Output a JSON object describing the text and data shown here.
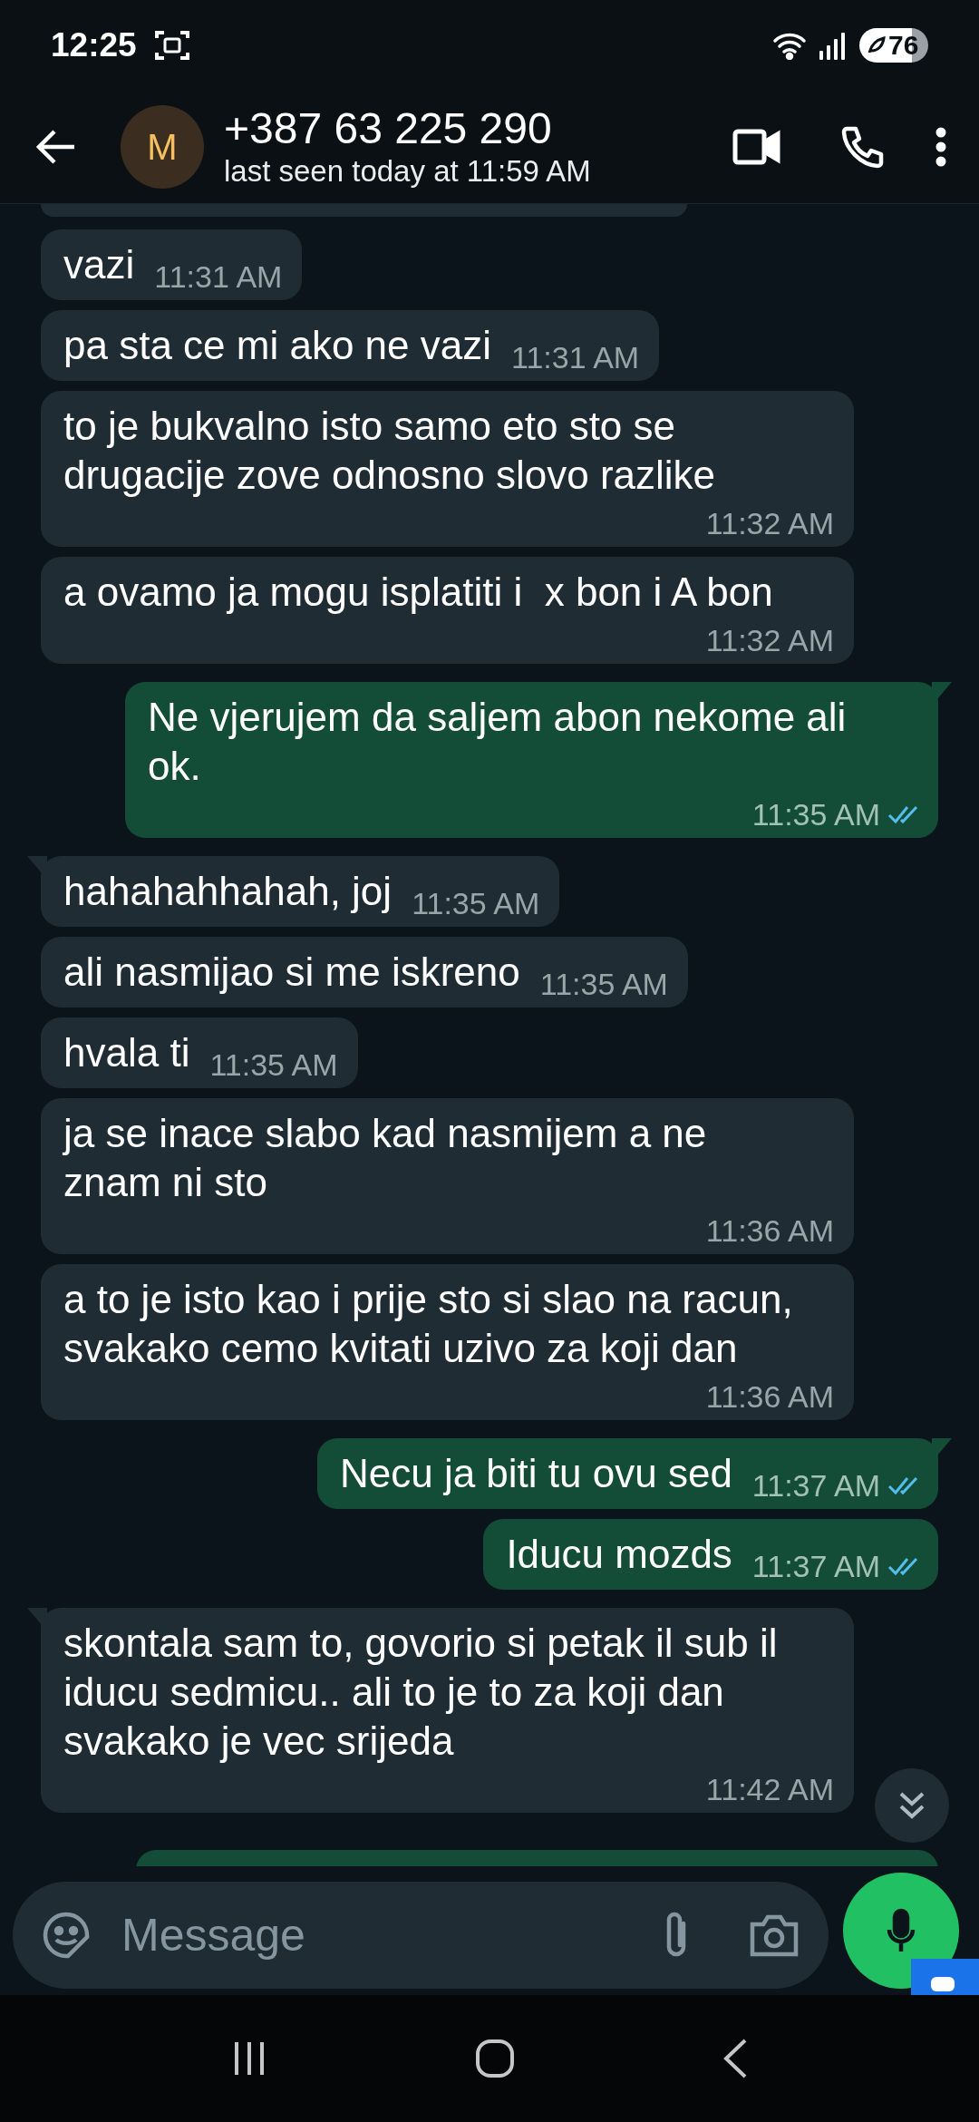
{
  "status_bar": {
    "time": "12:25",
    "battery": "76"
  },
  "header": {
    "avatar_letter": "M",
    "name": "+387 63 225 290",
    "last_seen": "last seen today at 11:59 AM"
  },
  "messages": [
    {
      "kind": "incoming",
      "tail": false,
      "text": "vazi",
      "time": "11:31 AM"
    },
    {
      "kind": "incoming",
      "tail": false,
      "text": "pa sta ce mi ako ne vazi",
      "time": "11:31 AM"
    },
    {
      "kind": "incoming",
      "tail": false,
      "text": "to je bukvalno isto samo eto sto se drugacije zove odnosno slovo razlike",
      "time": "11:32 AM"
    },
    {
      "kind": "incoming",
      "tail": false,
      "text": "a ovamo ja mogu isplatiti i  x bon i A bon",
      "time": "11:32 AM"
    },
    {
      "kind": "outgoing",
      "tail": true,
      "text": "Ne vjerujem da saljem abon nekome ali ok.",
      "time": "11:35 AM",
      "read": true
    },
    {
      "kind": "incoming",
      "tail": true,
      "text": "hahahahhahah, joj",
      "time": "11:35 AM"
    },
    {
      "kind": "incoming",
      "tail": false,
      "text": "ali nasmijao si me iskreno",
      "time": "11:35 AM"
    },
    {
      "kind": "incoming",
      "tail": false,
      "text": "hvala ti",
      "time": "11:35 AM"
    },
    {
      "kind": "incoming",
      "tail": false,
      "text": "ja se inace slabo kad nasmijem a ne znam ni sto",
      "time": "11:36 AM"
    },
    {
      "kind": "incoming",
      "tail": false,
      "text": "a to je isto kao i prije sto si slao na racun, svakako cemo kvitati uzivo za koji dan",
      "time": "11:36 AM"
    },
    {
      "kind": "outgoing",
      "tail": true,
      "text": "Necu ja biti tu ovu sed",
      "time": "11:37 AM",
      "read": true
    },
    {
      "kind": "outgoing",
      "tail": false,
      "text": "Iducu mozds",
      "time": "11:37 AM",
      "read": true
    },
    {
      "kind": "incoming",
      "tail": true,
      "text": "skontala sam to, govorio si petak il sub il iducu sedmicu.. ali to je to za koji dan svakako je vec srijeda",
      "time": "11:42 AM"
    }
  ],
  "composer": {
    "placeholder": "Message"
  }
}
